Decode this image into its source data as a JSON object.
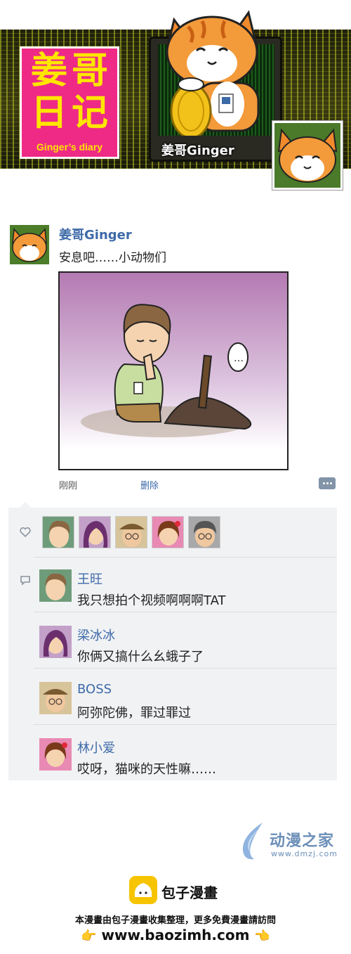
{
  "header": {
    "logo_cn": "姜哥日记",
    "logo_en": "Ginger’s diary",
    "caption": "姜哥Ginger"
  },
  "post": {
    "username": "姜哥Ginger",
    "text": "安息吧……小动物们",
    "time": "刚刚",
    "delete_label": "删除",
    "bubble_text": "…"
  },
  "likes": {
    "icon": "heart-icon",
    "avatars": [
      "wang-wang",
      "liang-bingbing",
      "boss",
      "lin-xiaoai",
      "grandma"
    ]
  },
  "comments": [
    {
      "name": "王旺",
      "text": "我只想拍个视频啊啊啊TAT"
    },
    {
      "name": "梁冰冰",
      "text": "你俩又搞什么幺蛾子了"
    },
    {
      "name": "BOSS",
      "text": "阿弥陀佛，罪过罪过"
    },
    {
      "name": "林小爱",
      "text": "哎呀，猫咪的天性嘛……"
    }
  ],
  "footer": {
    "dmzj_name": "动漫之家",
    "dmzj_url": "www.dmzj.com",
    "baozi_name": "包子漫畫",
    "baozi_note": "本漫畫由包子漫畫收集整理，更多免費漫畫請訪問",
    "baozi_url": "www.baozimh.com",
    "hand_left": "👉",
    "hand_right": "👈"
  },
  "colors": {
    "link_blue": "#3d6aa8",
    "logo_pink": "#ee2a86",
    "logo_yellow": "#ffe600",
    "panel_bg": "#f1f2f4"
  }
}
